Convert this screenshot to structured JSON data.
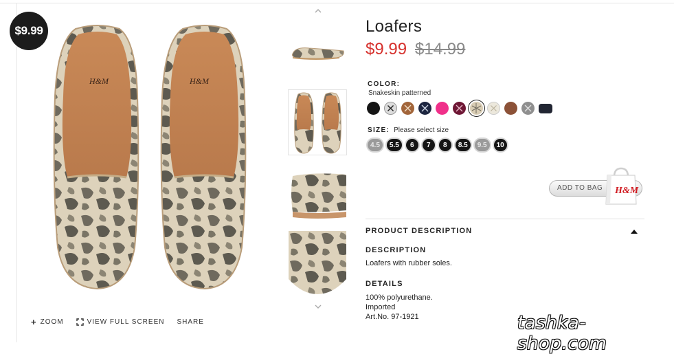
{
  "badge": {
    "price": "$9.99"
  },
  "product": {
    "title": "Loafers",
    "price_now": "$9.99",
    "price_old": "$14.99"
  },
  "image_tools": {
    "zoom": "ZOOM",
    "full_screen": "VIEW FULL SCREEN",
    "share": "SHARE"
  },
  "main_image": {
    "brand_text": "H&M"
  },
  "color": {
    "label": "COLOR:",
    "selected": "Snakeskin patterned",
    "swatches": [
      {
        "name": "black",
        "hex": "#151515"
      },
      {
        "name": "black-white-pattern",
        "hex": "#dddddd"
      },
      {
        "name": "tan-pattern",
        "hex": "#a2653a"
      },
      {
        "name": "navy-pattern",
        "hex": "#1d2640"
      },
      {
        "name": "pink",
        "hex": "#f0308a"
      },
      {
        "name": "burgundy-pattern",
        "hex": "#6e1735"
      },
      {
        "name": "snakeskin",
        "hex": "#d9cdb4"
      },
      {
        "name": "light-pattern",
        "hex": "#ece8dc"
      },
      {
        "name": "brown",
        "hex": "#8c5238"
      },
      {
        "name": "grey-pattern",
        "hex": "#8f8f8f"
      },
      {
        "name": "dark-navy",
        "hex": "#222633"
      }
    ]
  },
  "size": {
    "label": "SIZE:",
    "hint": "Please select size",
    "options": [
      {
        "value": "4.5",
        "available": false
      },
      {
        "value": "5.5",
        "available": true
      },
      {
        "value": "6",
        "available": true
      },
      {
        "value": "7",
        "available": true
      },
      {
        "value": "8",
        "available": true
      },
      {
        "value": "8.5",
        "available": true
      },
      {
        "value": "9.5",
        "available": false
      },
      {
        "value": "10",
        "available": true
      }
    ]
  },
  "add_to_bag": {
    "label": "ADD TO BAG",
    "brand": "H&M"
  },
  "product_description": {
    "header": "PRODUCT DESCRIPTION",
    "description_title": "DESCRIPTION",
    "description_text": "Loafers with rubber soles.",
    "details_title": "DETAILS",
    "details_lines": [
      "100% polyurethane.",
      "Imported",
      "Art.No. 97-1921"
    ]
  },
  "watermark": "tashka-shop.com",
  "colors": {
    "sale_red": "#d6322e",
    "badge_black": "#1c1c1c"
  }
}
